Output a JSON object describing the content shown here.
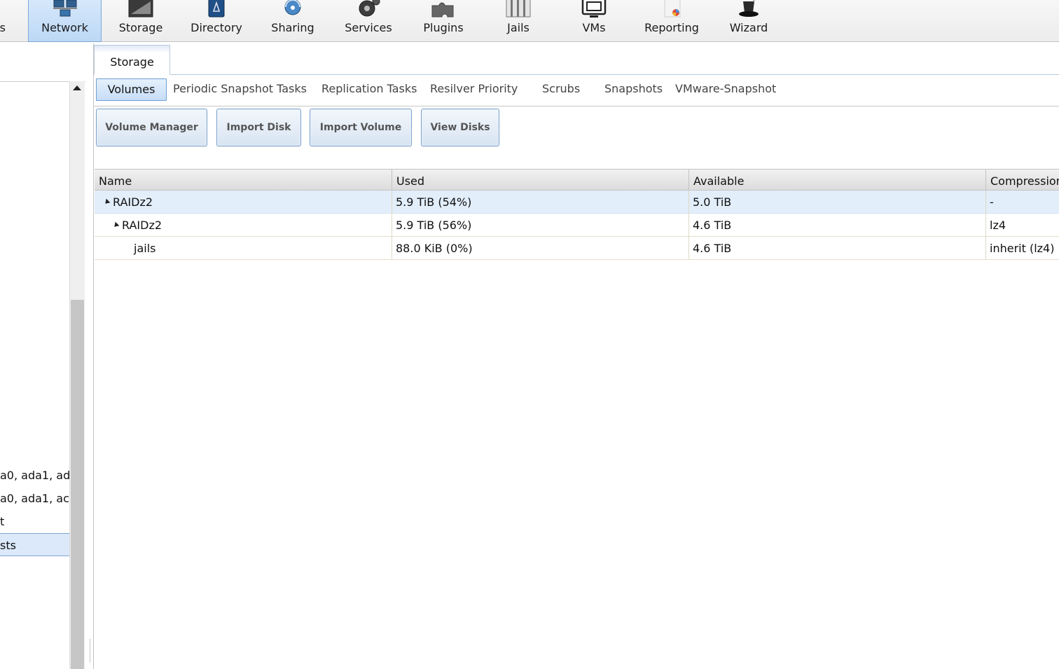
{
  "topbar": {
    "items": [
      {
        "label": "s",
        "icon": "system-icon"
      },
      {
        "label": "Network",
        "icon": "network-icon",
        "active": true
      },
      {
        "label": "Storage",
        "icon": "storage-icon"
      },
      {
        "label": "Directory",
        "icon": "directory-icon"
      },
      {
        "label": "Sharing",
        "icon": "sharing-icon"
      },
      {
        "label": "Services",
        "icon": "services-gear-icon"
      },
      {
        "label": "Plugins",
        "icon": "plugins-puzzle-icon"
      },
      {
        "label": "Jails",
        "icon": "jails-icon"
      },
      {
        "label": "VMs",
        "icon": "vms-monitor-icon"
      },
      {
        "label": "Reporting",
        "icon": "reporting-icon"
      },
      {
        "label": "Wizard",
        "icon": "wizard-hat-icon"
      }
    ]
  },
  "left_tree": {
    "rows": [
      {
        "text": "a0, ada1, ad"
      },
      {
        "text": "a0, ada1, ac"
      },
      {
        "text": "t"
      },
      {
        "text": "sts",
        "selected": true
      }
    ]
  },
  "main": {
    "tab": "Storage",
    "subtabs": [
      {
        "label": "Volumes",
        "active": true
      },
      {
        "label": "Periodic Snapshot Tasks"
      },
      {
        "label": "Replication Tasks"
      },
      {
        "label": "Resilver Priority"
      },
      {
        "label": "Scrubs"
      },
      {
        "label": "Snapshots"
      },
      {
        "label": "VMware-Snapshot"
      }
    ],
    "buttons": {
      "volume_manager": "Volume Manager",
      "import_disk": "Import Disk",
      "import_volume": "Import Volume",
      "view_disks": "View Disks"
    },
    "grid": {
      "columns": [
        "Name",
        "Used",
        "Available",
        "Compression"
      ],
      "rows": [
        {
          "name": "RAIDz2",
          "used": "5.9 TiB (54%)",
          "available": "5.0 TiB",
          "compression": "-"
        },
        {
          "name": "RAIDz2",
          "used": "5.9 TiB (56%)",
          "available": "4.6 TiB",
          "compression": "lz4"
        },
        {
          "name": "jails",
          "used": "88.0 KiB (0%)",
          "available": "4.6 TiB",
          "compression": "inherit (lz4)"
        }
      ]
    }
  },
  "colors": {
    "accent": "#bcd8f6",
    "accent_border": "#7ea9d6",
    "selected_row": "#e2eefa"
  }
}
